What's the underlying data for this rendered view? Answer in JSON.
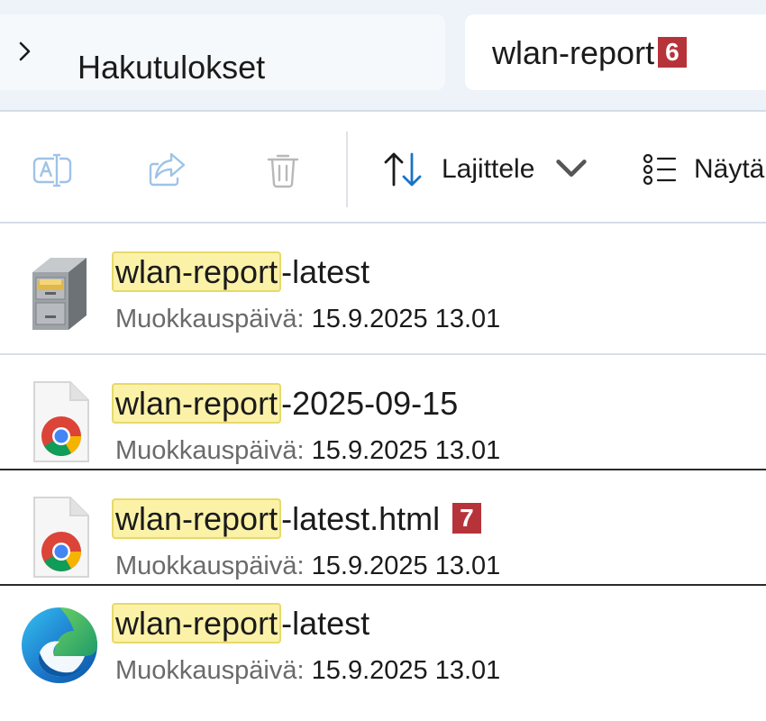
{
  "address": {
    "breadcrumb": "Hakutulokset",
    "search_value": "wlan-report",
    "search_badge": "6"
  },
  "toolbar": {
    "rename_icon": "rename-icon",
    "share_icon": "share-icon",
    "delete_icon": "trash-icon",
    "sort_label": "Lajittele",
    "view_label": "Näytä"
  },
  "results": [
    {
      "match": "wlan-report",
      "rest": "-latest",
      "meta_label": "Muokkauspäivä:",
      "meta_value": "15.9.2025 13.01",
      "icon": "file-cabinet-icon",
      "badge": ""
    },
    {
      "match": "wlan-report",
      "rest": "-2025-09-15",
      "meta_label": "Muokkauspäivä:",
      "meta_value": "15.9.2025 13.01",
      "icon": "chrome-html-icon",
      "badge": ""
    },
    {
      "match": "wlan-report",
      "rest": "-latest.html",
      "meta_label": "Muokkauspäivä:",
      "meta_value": "15.9.2025 13.01",
      "icon": "chrome-html-icon",
      "badge": "7"
    },
    {
      "match": "wlan-report",
      "rest": "-latest",
      "meta_label": "Muokkauspäivä:",
      "meta_value": "15.9.2025 13.01",
      "icon": "edge-icon",
      "badge": ""
    }
  ],
  "colors": {
    "badge": "#b7333a",
    "highlight": "#fbf2a8",
    "accent": "#1a73c8"
  }
}
